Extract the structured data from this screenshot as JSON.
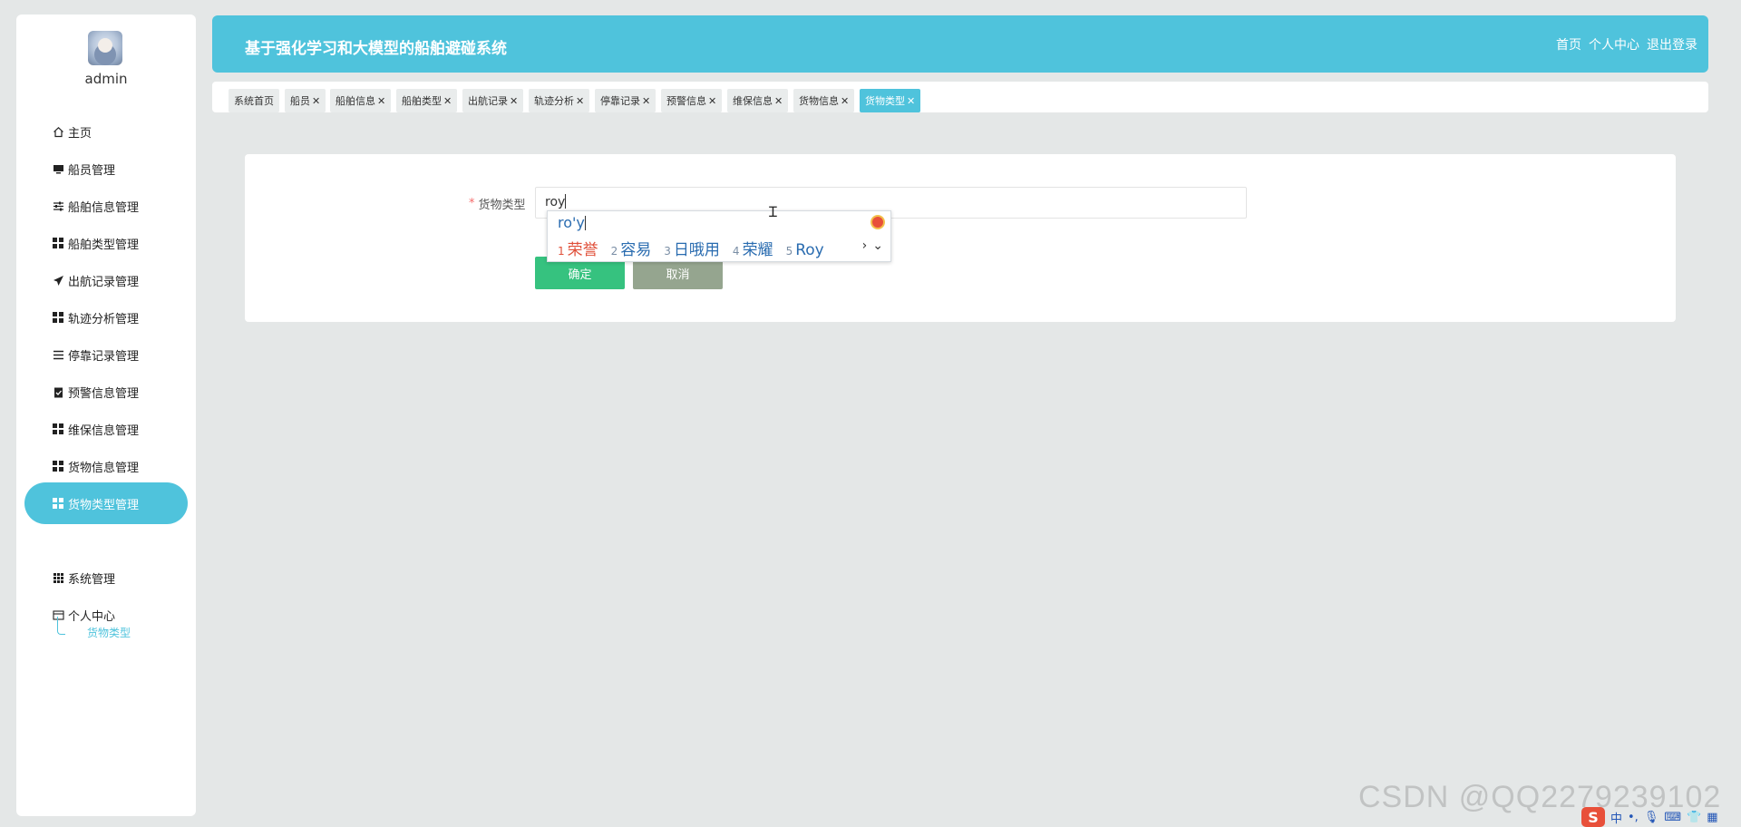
{
  "sidebar": {
    "username": "admin",
    "items": [
      {
        "label": "主页",
        "icon": "home-icon"
      },
      {
        "label": "船员管理",
        "icon": "monitor-icon"
      },
      {
        "label": "船舶信息管理",
        "icon": "sliders-icon"
      },
      {
        "label": "船舶类型管理",
        "icon": "grid-icon"
      },
      {
        "label": "出航记录管理",
        "icon": "send-icon"
      },
      {
        "label": "轨迹分析管理",
        "icon": "grid-icon"
      },
      {
        "label": "停靠记录管理",
        "icon": "list-icon"
      },
      {
        "label": "预警信息管理",
        "icon": "clipboard-check-icon"
      },
      {
        "label": "维保信息管理",
        "icon": "grid-icon"
      },
      {
        "label": "货物信息管理",
        "icon": "grid-icon"
      },
      {
        "label": "货物类型管理",
        "icon": "grid-icon",
        "active": true
      },
      {
        "label": "系统管理",
        "icon": "grid-nine-icon"
      },
      {
        "label": "个人中心",
        "icon": "card-icon"
      }
    ],
    "subitem": "货物类型"
  },
  "header": {
    "title": "基于强化学习和大模型的船舶避碰系统",
    "links": [
      "首页",
      "个人中心",
      "退出登录"
    ]
  },
  "tabs": [
    {
      "label": "系统首页",
      "closable": false
    },
    {
      "label": "船员",
      "closable": true
    },
    {
      "label": "船舶信息",
      "closable": true
    },
    {
      "label": "船舶类型",
      "closable": true
    },
    {
      "label": "出航记录",
      "closable": true
    },
    {
      "label": "轨迹分析",
      "closable": true
    },
    {
      "label": "停靠记录",
      "closable": true
    },
    {
      "label": "预警信息",
      "closable": true
    },
    {
      "label": "维保信息",
      "closable": true
    },
    {
      "label": "货物信息",
      "closable": true
    },
    {
      "label": "货物类型",
      "closable": true,
      "active": true
    }
  ],
  "form": {
    "required_mark": "*",
    "label": "货物类型",
    "value": "roy",
    "confirm": "确定",
    "cancel": "取消"
  },
  "ime": {
    "composition": "ro'y",
    "candidates": [
      {
        "n": "1",
        "text": "荣誉"
      },
      {
        "n": "2",
        "text": "容易"
      },
      {
        "n": "3",
        "text": "日哦用"
      },
      {
        "n": "4",
        "text": "荣耀"
      },
      {
        "n": "5",
        "text": "Roy"
      }
    ],
    "next": "›",
    "expand": "⌄"
  },
  "watermark": "CSDN @QQ2279239102",
  "tray": {
    "lang": "中",
    "punct": "•,"
  },
  "colors": {
    "accent": "#4fc3dc",
    "confirm": "#36c27f",
    "cancel": "#95a58f",
    "background": "#e4e7e7"
  }
}
